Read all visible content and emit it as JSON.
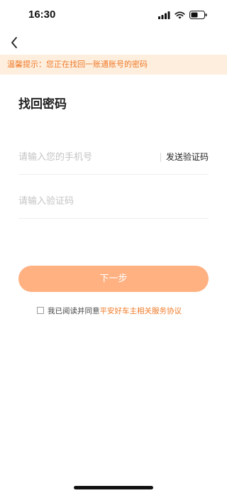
{
  "status_bar": {
    "time": "16:30",
    "icons": [
      "signal-icon",
      "wifi-icon",
      "battery-icon"
    ]
  },
  "nav": {
    "back_icon": "chevron-left-icon"
  },
  "notice": {
    "text": "温馨提示：您正在找回一账通账号的密码"
  },
  "form": {
    "title": "找回密码",
    "phone_placeholder": "请输入您的手机号",
    "phone_value": "",
    "send_code_label": "发送验证码",
    "code_placeholder": "请输入验证码",
    "code_value": "",
    "next_label": "下一步"
  },
  "agreement": {
    "checked": false,
    "prefix": "我已阅读并同意",
    "link_text": "平安好车主相关服务协议"
  },
  "colors": {
    "accent": "#f07a28",
    "notice_bg": "#fdeede",
    "button_bg": "#ffb182"
  }
}
